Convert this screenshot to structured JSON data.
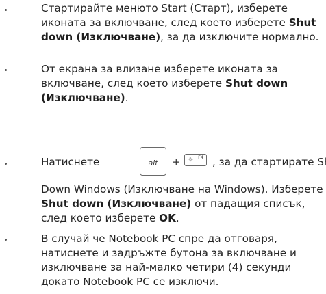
{
  "bullets": [
    {
      "parts": [
        {
          "text": "Стартирайте менюто Start (Старт), изберете иконата за включване, след което изберете ",
          "bold": false
        },
        {
          "text": "Shut down (Изключване)",
          "bold": true
        },
        {
          "text": ", за да изключите нормално.",
          "bold": false
        }
      ]
    },
    {
      "parts": [
        {
          "text": "От екрана за влизане изберете иконата за включване, след което изберете ",
          "bold": false
        },
        {
          "text": "Shut down (Изключване)",
          "bold": true
        },
        {
          "text": ".",
          "bold": false
        }
      ]
    },
    {
      "key_line": {
        "before": "Натиснете",
        "alt_key": "alt",
        "plus": "+",
        "f4_key_label": "F4",
        "f4_key_icon": "☼",
        "after": ", за да стартирате Shut"
      },
      "parts": [
        {
          "text": "Down Windows (Изключване на Windows). Изберете ",
          "bold": false
        },
        {
          "text": "Shut down (Изключване)",
          "bold": true
        },
        {
          "text": " от падащия списък, след което изберете ",
          "bold": false
        },
        {
          "text": "OK",
          "bold": true
        },
        {
          "text": ".",
          "bold": false
        }
      ]
    },
    {
      "parts": [
        {
          "text": "В случай че Notebook PC спре да отговаря, натиснете и задръжте бутона за включване и изключване за най-малко четири (4) секунди докато Notebook PC се изключи.",
          "bold": false
        }
      ]
    }
  ]
}
